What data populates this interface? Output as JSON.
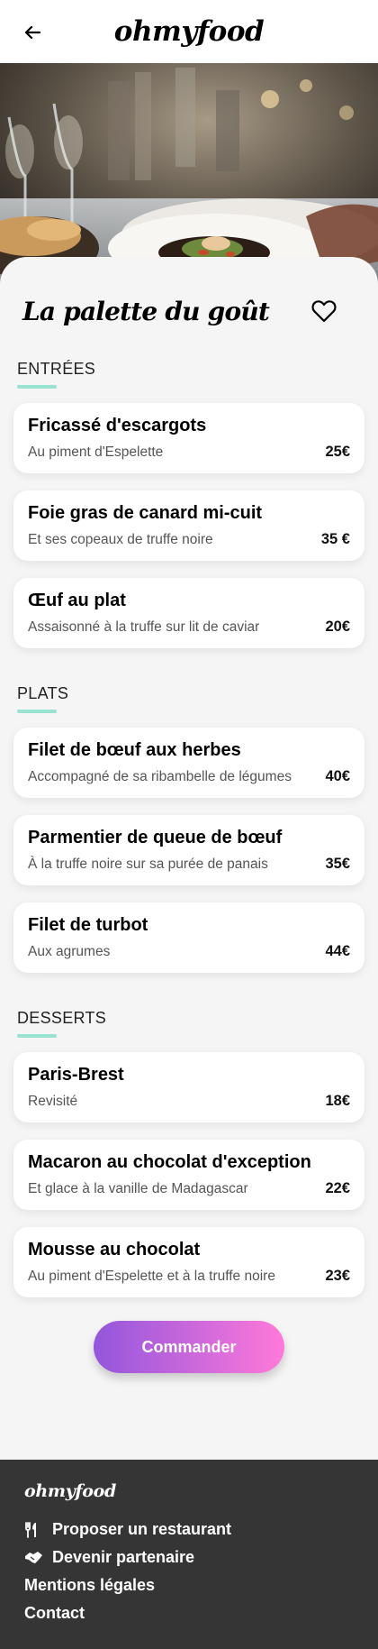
{
  "header": {
    "logo": "ohmyfood",
    "back_icon": "arrow-left-icon"
  },
  "restaurant": {
    "title": "La palette du goût",
    "heart_icon": "heart-outline-icon"
  },
  "sections": [
    {
      "title": "ENTRÉES",
      "dishes": [
        {
          "name": "Fricassé d'escargots",
          "description": "Au piment d'Espelette",
          "price": "25€"
        },
        {
          "name": "Foie gras de canard mi-cuit",
          "description": "Et ses copeaux de truffe noire",
          "price": "35 €"
        },
        {
          "name": "Œuf au plat",
          "description": "Assaisonné à la truffe sur lit de caviar",
          "price": "20€"
        }
      ]
    },
    {
      "title": "PLATS",
      "dishes": [
        {
          "name": "Filet de bœuf aux herbes",
          "description": "Accompagné de sa ribambelle de légumes",
          "price": "40€"
        },
        {
          "name": "Parmentier de queue de bœuf",
          "description": "À la truffe noire sur sa purée de panais",
          "price": "35€"
        },
        {
          "name": "Filet de turbot",
          "description": "Aux agrumes",
          "price": "44€"
        }
      ]
    },
    {
      "title": "DESSERTS",
      "dishes": [
        {
          "name": "Paris-Brest",
          "description": "Revisité",
          "price": "18€"
        },
        {
          "name": "Macaron au chocolat d'exception",
          "description": "Et glace à la vanille de Madagascar",
          "price": "22€"
        },
        {
          "name": "Mousse au chocolat",
          "description": "Au piment d'Espelette et à la truffe noire",
          "price": "23€"
        }
      ]
    }
  ],
  "order_button": "Commander",
  "footer": {
    "logo": "ohmyfood",
    "links": [
      {
        "label": "Proposer un restaurant",
        "icon": "utensils-icon"
      },
      {
        "label": "Devenir partenaire",
        "icon": "handshake-icon"
      },
      {
        "label": "Mentions légales",
        "icon": ""
      },
      {
        "label": "Contact",
        "icon": ""
      }
    ]
  },
  "colors": {
    "accent_bar": "#99e2d0",
    "button_start": "#9356dc",
    "button_end": "#ff79da",
    "footer_bg": "#353535"
  }
}
